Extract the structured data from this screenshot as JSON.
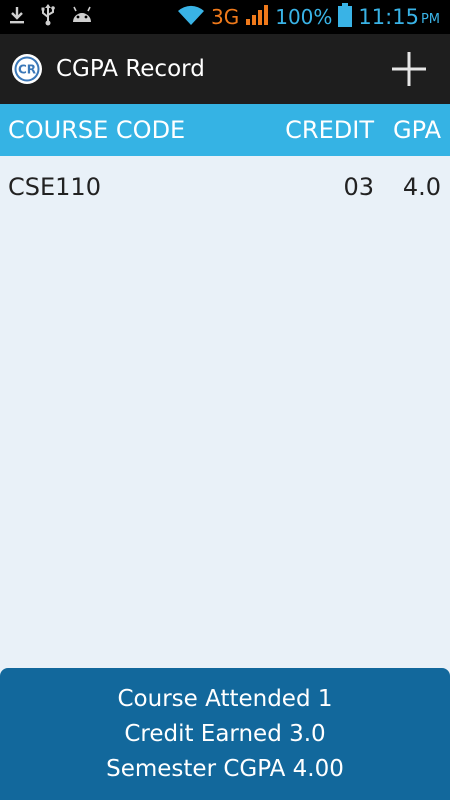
{
  "status_bar": {
    "network_type": "3G",
    "battery_percent": "100%",
    "time": "11:15",
    "ampm": "PM",
    "icons": [
      "download-icon",
      "usb-icon",
      "android-debug-icon",
      "wifi-icon",
      "signal-icon",
      "battery-icon"
    ]
  },
  "action_bar": {
    "title": "CGPA Record",
    "logo_text": "CR",
    "add_icon": "plus-icon"
  },
  "table": {
    "columns": [
      "COURSE CODE",
      "CREDIT",
      "GPA"
    ],
    "rows": [
      {
        "course": "CSE110",
        "credit": "03",
        "gpa": "4.0"
      }
    ]
  },
  "summary": {
    "course_attended": "Course Attended 1",
    "credit_earned": "Credit Earned 3.0",
    "semester_cgpa": "Semester CGPA 4.00"
  },
  "colors": {
    "status_bar_bg": "#000000",
    "status_accent": "#39b3e6",
    "network_accent": "#f07a1b",
    "action_bar_bg": "#1e1e1e",
    "header_bg": "#35b3e4",
    "body_bg": "#e9f1f8",
    "summary_bg": "#12689c"
  }
}
